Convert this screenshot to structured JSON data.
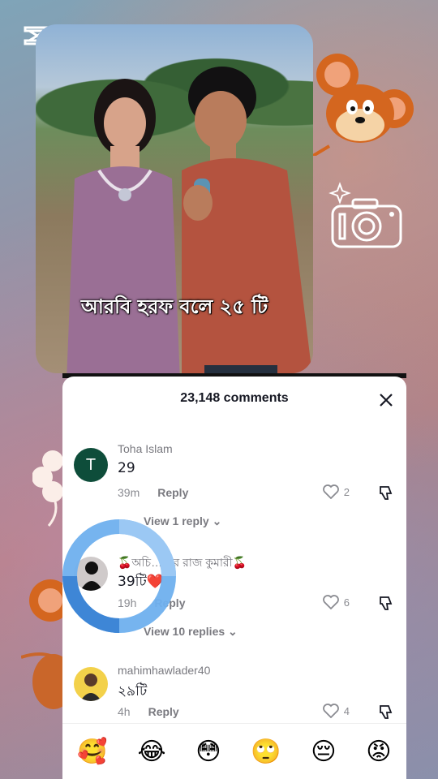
{
  "video": {
    "caption": "আরবি হরফ বলে ২৫ টি"
  },
  "comments_sheet": {
    "title": "23,148 comments",
    "comments": [
      {
        "avatar_letter": "T",
        "username": "Toha Islam",
        "text": "29",
        "time": "39m",
        "reply_label": "Reply",
        "likes": "2",
        "view_replies": "View 1 reply"
      },
      {
        "username": "🍒অচি…রের রাজ কুমারী🍒",
        "text": "39টি❤️",
        "time": "19h",
        "reply_label": "Reply",
        "likes": "6",
        "view_replies": "View 10 replies"
      },
      {
        "username": "mahimhawlader40",
        "text": "২৯টি",
        "time": "4h",
        "reply_label": "Reply",
        "likes": "4"
      }
    ],
    "emoji_bar": [
      "🥰",
      "😂",
      "😳",
      "🙄",
      "😔",
      "😡"
    ]
  },
  "colors": {
    "ring": "#5aa0e6",
    "text_primary": "#161823",
    "text_secondary": "#8a8b91"
  }
}
